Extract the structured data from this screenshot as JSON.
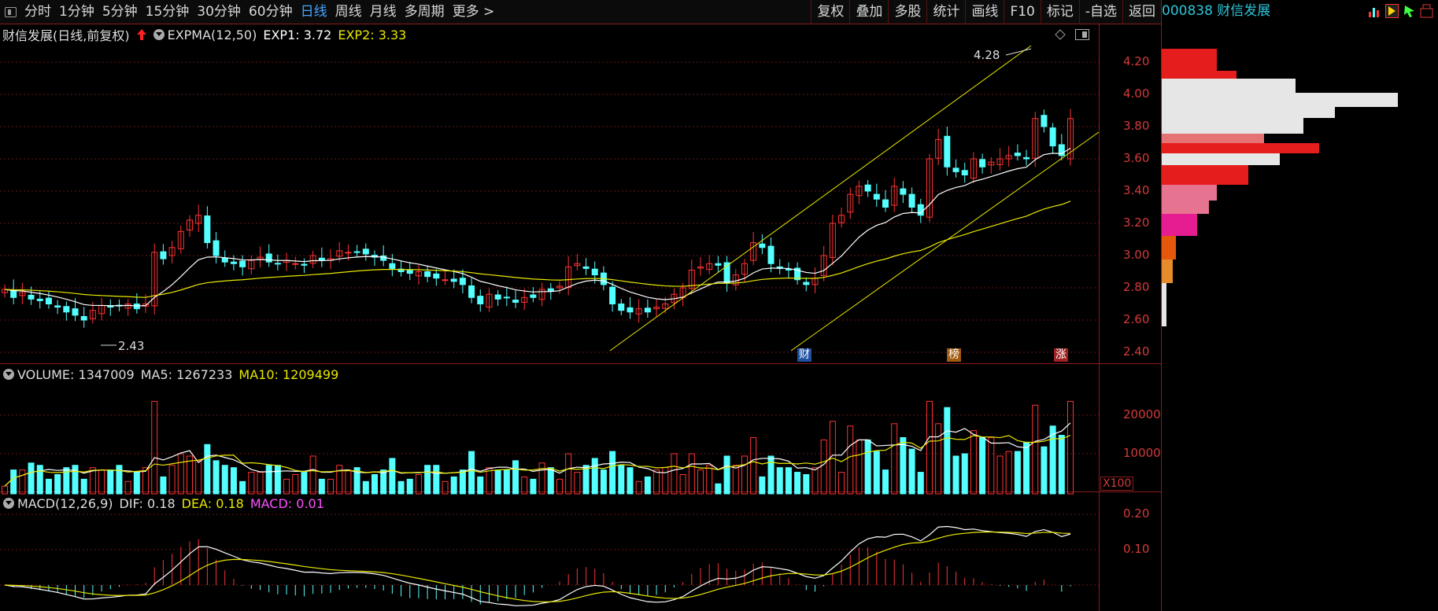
{
  "toolbar": {
    "periods": [
      "分时",
      "1分钟",
      "5分钟",
      "15分钟",
      "30分钟",
      "60分钟",
      "日线",
      "周线",
      "月线",
      "多周期",
      "更多 >"
    ],
    "active_period": "日线",
    "buttons": [
      "复权",
      "叠加",
      "多股",
      "统计",
      "画线",
      "F10",
      "标记",
      "-自选",
      "返回"
    ]
  },
  "stock": {
    "code_name": "000838 财信发展"
  },
  "price_panel": {
    "title": "财信发展(日线,前复权)",
    "indicator": "EXPMA(12,50)",
    "exp1": "EXP1: 3.72",
    "exp2": "EXP2: 3.33",
    "high_label": "4.28",
    "low_label": "2.43",
    "y_ticks": [
      "4.20",
      "4.00",
      "3.80",
      "3.60",
      "3.40",
      "3.20",
      "3.00",
      "2.80",
      "2.60",
      "2.40"
    ],
    "badges": [
      "财",
      "榜",
      "涨"
    ]
  },
  "volume_panel": {
    "vol": "VOLUME: 1347009",
    "ma5": "MA5: 1267233",
    "ma10": "MA10: 1209499",
    "y_ticks": [
      "20000",
      "10000"
    ],
    "unit": "X100"
  },
  "macd_panel": {
    "title": "MACD(12,26,9)",
    "dif": "DIF: 0.18",
    "dea": "DEA: 0.18",
    "macd": "MACD: 0.01",
    "y_ticks": [
      "0.20",
      "0.10"
    ]
  },
  "colors": {
    "up": "#ff3232",
    "down": "#54ffff",
    "exp1": "#ffffff",
    "exp2": "#e8e800",
    "macd": "#ff50ff",
    "grid": "#6a1414"
  },
  "chart_data": {
    "type": "candlestick",
    "close": [
      2.79,
      2.74,
      2.77,
      2.73,
      2.72,
      2.7,
      2.68,
      2.65,
      2.63,
      2.6,
      2.66,
      2.69,
      2.68,
      2.69,
      2.7,
      2.67,
      2.7,
      3.02,
      2.98,
      3.05,
      3.15,
      3.22,
      3.25,
      3.08,
      3.0,
      2.96,
      2.95,
      2.93,
      2.97,
      2.99,
      2.96,
      2.95,
      2.97,
      2.95,
      2.94,
      3.0,
      2.97,
      2.98,
      3.03,
      3.02,
      3.02,
      3.01,
      2.99,
      2.97,
      2.92,
      2.9,
      2.89,
      2.9,
      2.87,
      2.86,
      2.85,
      2.84,
      2.82,
      2.74,
      2.7,
      2.76,
      2.73,
      2.74,
      2.71,
      2.74,
      2.74,
      2.79,
      2.78,
      2.81,
      2.93,
      2.95,
      2.92,
      2.88,
      2.82,
      2.7,
      2.66,
      2.65,
      2.67,
      2.65,
      2.68,
      2.7,
      2.76,
      2.8,
      2.91,
      2.93,
      2.95,
      2.94,
      2.83,
      2.88,
      2.95,
      3.08,
      3.05,
      2.95,
      2.92,
      2.91,
      2.85,
      2.82,
      2.86,
      3.0,
      3.2,
      3.25,
      3.38,
      3.43,
      3.4,
      3.35,
      3.3,
      3.43,
      3.38,
      3.3,
      3.25,
      3.6,
      3.72,
      3.55,
      3.52,
      3.5,
      3.6,
      3.55,
      3.58,
      3.6,
      3.62,
      3.62,
      3.6,
      3.85,
      3.8,
      3.68,
      3.62,
      3.85
    ]
  }
}
